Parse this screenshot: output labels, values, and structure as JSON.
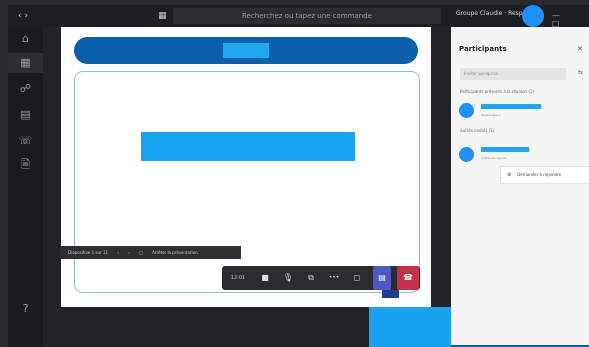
{
  "window": {
    "nav_symbols": "‹ ›",
    "search_text": "Recherchez ou tapez une commande",
    "grid_icon": "grid-icon",
    "user_chip": "Groupe Claudie · Resp...  ›",
    "win_controls": "— ☐ ✕"
  },
  "rail": {
    "items": [
      {
        "icon": "⌂",
        "label": ""
      },
      {
        "icon": "▦",
        "label": ""
      },
      {
        "icon": "☍",
        "label": ""
      },
      {
        "icon": "▤",
        "label": ""
      },
      {
        "icon": "☏",
        "label": ""
      },
      {
        "icon": "🗎",
        "label": ""
      }
    ],
    "bottom_icon": "?"
  },
  "stage": {
    "pres_controls": [
      "Diapositive 1 sur 11",
      "‹",
      "›",
      "▢",
      "Arrêter la présentation"
    ],
    "call_bar": {
      "timer": "12:01",
      "camera_icon": "■",
      "mic_icon": "🎙",
      "share_tray_icon": "⧉",
      "more_icon": "•••",
      "chat_icon": "◻",
      "participants_icon": "▤",
      "hangup_icon": "☎"
    }
  },
  "panel": {
    "title": "Participants",
    "close": "✕",
    "invite_placeholder": "Inviter quelqu'un",
    "invite_icon": "⇆",
    "section_present": "Participants présents à la réunion (1)",
    "present_role": "Organisateur",
    "section_others": "Autres invités (1)",
    "other_role": "Invité pas rejoint",
    "menu_item": "Demander à rejoindre",
    "menu_icon": "⊕"
  },
  "colors": {
    "accent_blue": "#19a3ef",
    "banner_navy": "#0b5fad",
    "hangup_red": "#c4314b",
    "share_purple": "#5058c7"
  }
}
